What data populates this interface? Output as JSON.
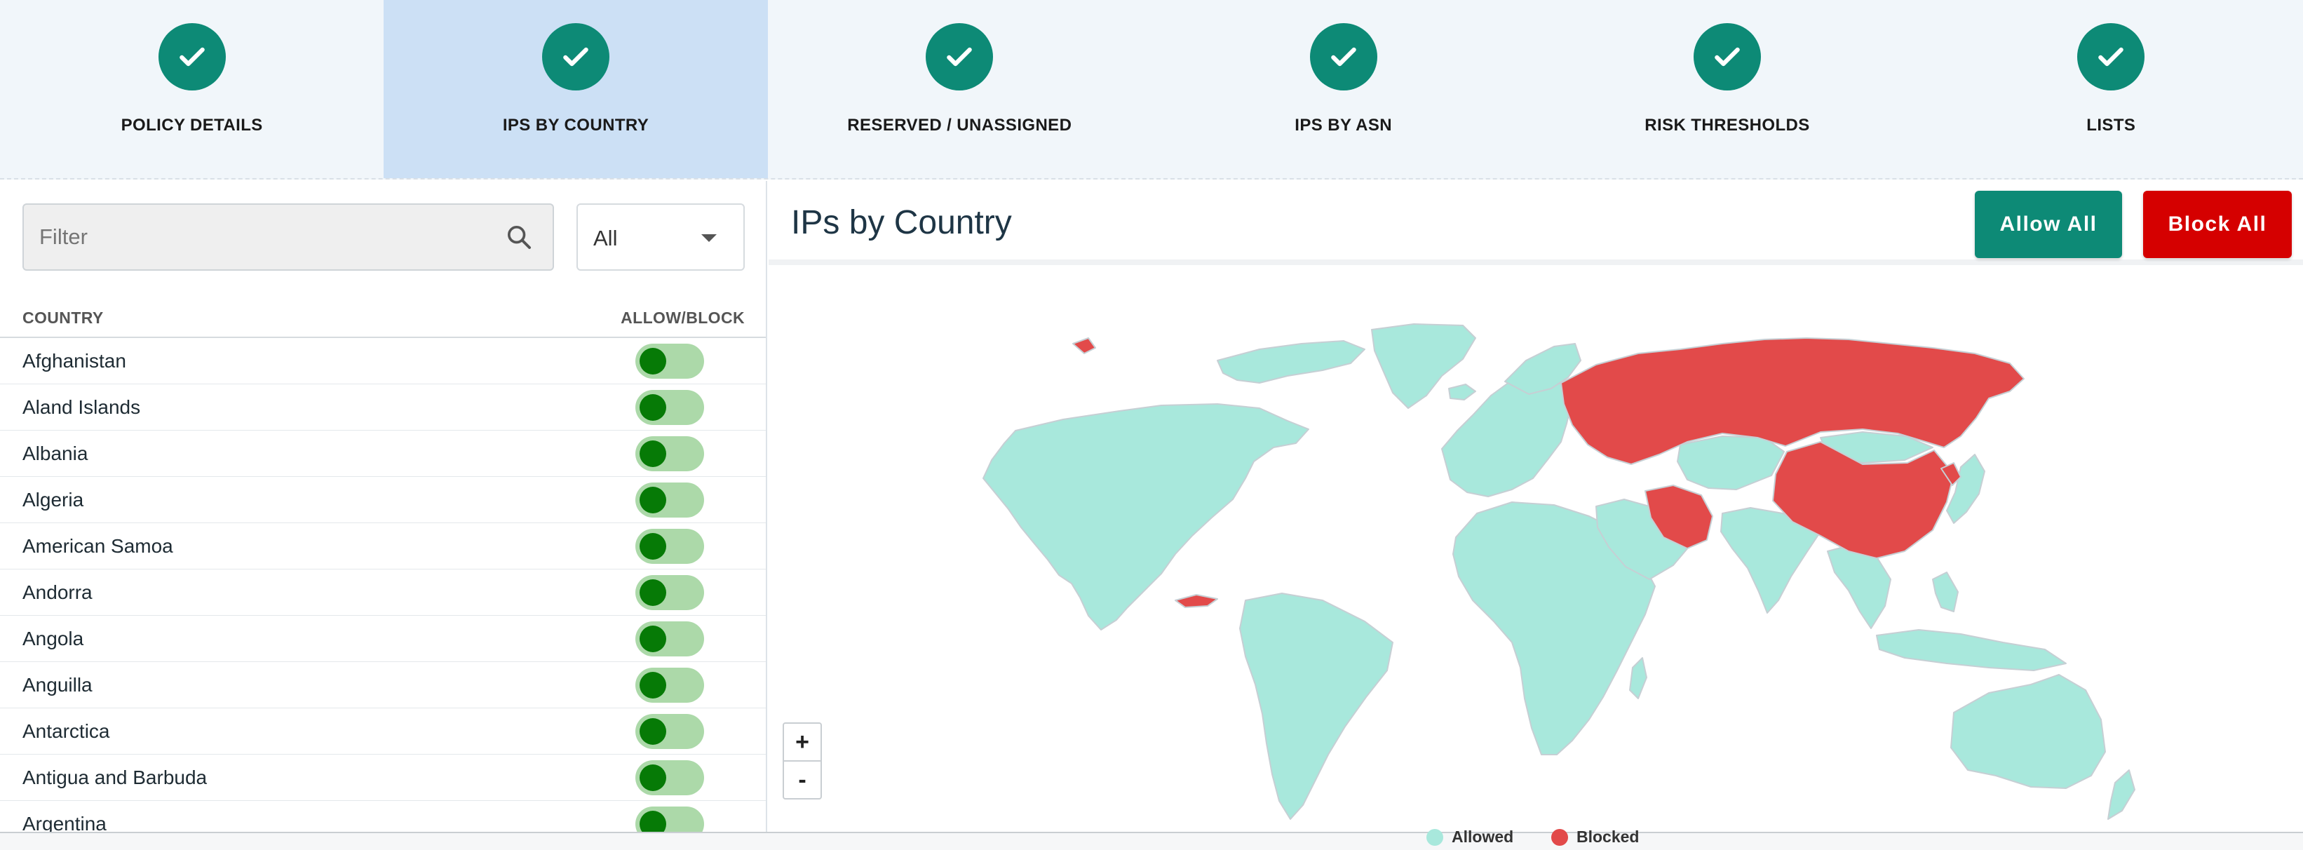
{
  "stepper": {
    "steps": [
      {
        "label": "POLICY DETAILS",
        "icon": "check-icon",
        "active": false
      },
      {
        "label": "IPS BY COUNTRY",
        "icon": "check-icon",
        "active": true
      },
      {
        "label": "RESERVED / UNASSIGNED",
        "icon": "check-icon",
        "active": false
      },
      {
        "label": "IPS BY ASN",
        "icon": "check-icon",
        "active": false
      },
      {
        "label": "RISK THRESHOLDS",
        "icon": "check-icon",
        "active": false
      },
      {
        "label": "LISTS",
        "icon": "check-icon",
        "active": false
      }
    ]
  },
  "filter": {
    "placeholder": "Filter",
    "icon": "search-icon"
  },
  "select": {
    "value": "All"
  },
  "table": {
    "col_country": "COUNTRY",
    "col_allow_block": "ALLOW/BLOCK",
    "rows": [
      {
        "name": "Afghanistan",
        "allowed": true
      },
      {
        "name": "Aland Islands",
        "allowed": true
      },
      {
        "name": "Albania",
        "allowed": true
      },
      {
        "name": "Algeria",
        "allowed": true
      },
      {
        "name": "American Samoa",
        "allowed": true
      },
      {
        "name": "Andorra",
        "allowed": true
      },
      {
        "name": "Angola",
        "allowed": true
      },
      {
        "name": "Anguilla",
        "allowed": true
      },
      {
        "name": "Antarctica",
        "allowed": true
      },
      {
        "name": "Antigua and Barbuda",
        "allowed": true
      },
      {
        "name": "Argentina",
        "allowed": true
      }
    ]
  },
  "panel": {
    "title": "IPs by Country",
    "allow_all": "Allow All",
    "block_all": "Block All"
  },
  "map": {
    "zoom_in": "+",
    "zoom_out": "-",
    "blocked_regions": [
      "russia",
      "china",
      "iran",
      "north-korea",
      "cuba"
    ]
  },
  "legend": [
    {
      "label": "Allowed",
      "color": "#a8e8dc"
    },
    {
      "label": "Blocked",
      "color": "#e24a4a"
    }
  ],
  "colors": {
    "accent": "#0d8a76",
    "danger": "#d50000",
    "step_active_bg": "#cce0f5",
    "toggle_track": "#acd9a9",
    "toggle_knob": "#067a06",
    "allowed": "#a8e8dc",
    "blocked": "#e24a4a"
  }
}
